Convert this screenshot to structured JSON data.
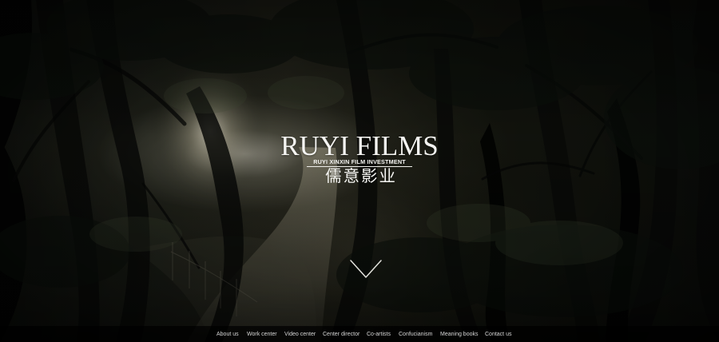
{
  "brand": {
    "name": "RUYI FILMS",
    "subtitle": "RUYI XINXIN FILM INVESTMENT",
    "chinese_name": "儒意影业"
  },
  "nav": {
    "items": [
      {
        "label": "About us"
      },
      {
        "label": "Work center"
      },
      {
        "label": "Video center"
      },
      {
        "label": "Center director"
      },
      {
        "label": "Co-artists"
      },
      {
        "label": "Confucianism"
      },
      {
        "label": "Meaning books"
      },
      {
        "label": "Contact us"
      }
    ]
  },
  "icons": {
    "scroll": "chevron-down-icon"
  },
  "colors": {
    "text": "#f5f5f2",
    "nav_background": "#000000",
    "nav_text": "#d8d8d8"
  }
}
